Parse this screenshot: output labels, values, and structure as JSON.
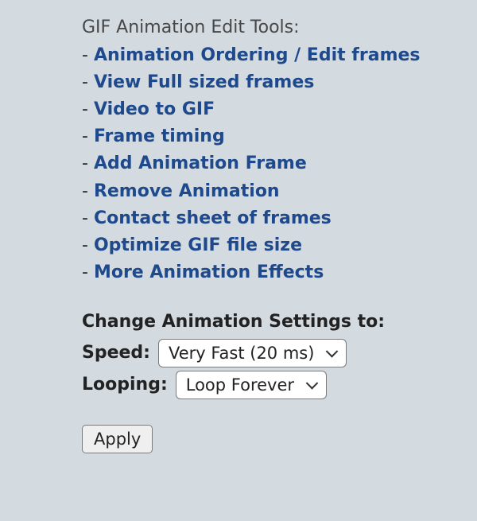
{
  "tools": {
    "title": "GIF Animation Edit Tools:",
    "items": [
      "Animation Ordering / Edit frames",
      "View Full sized frames",
      "Video to GIF",
      "Frame timing",
      "Add Animation Frame",
      "Remove Animation",
      "Contact sheet of frames",
      "Optimize GIF file size",
      "More Animation Effects"
    ]
  },
  "settings": {
    "title": "Change Animation Settings to:",
    "speed_label": "Speed:",
    "speed_value": "Very Fast (20 ms)",
    "looping_label": "Looping:",
    "looping_value": "Loop Forever",
    "apply_label": "Apply"
  }
}
